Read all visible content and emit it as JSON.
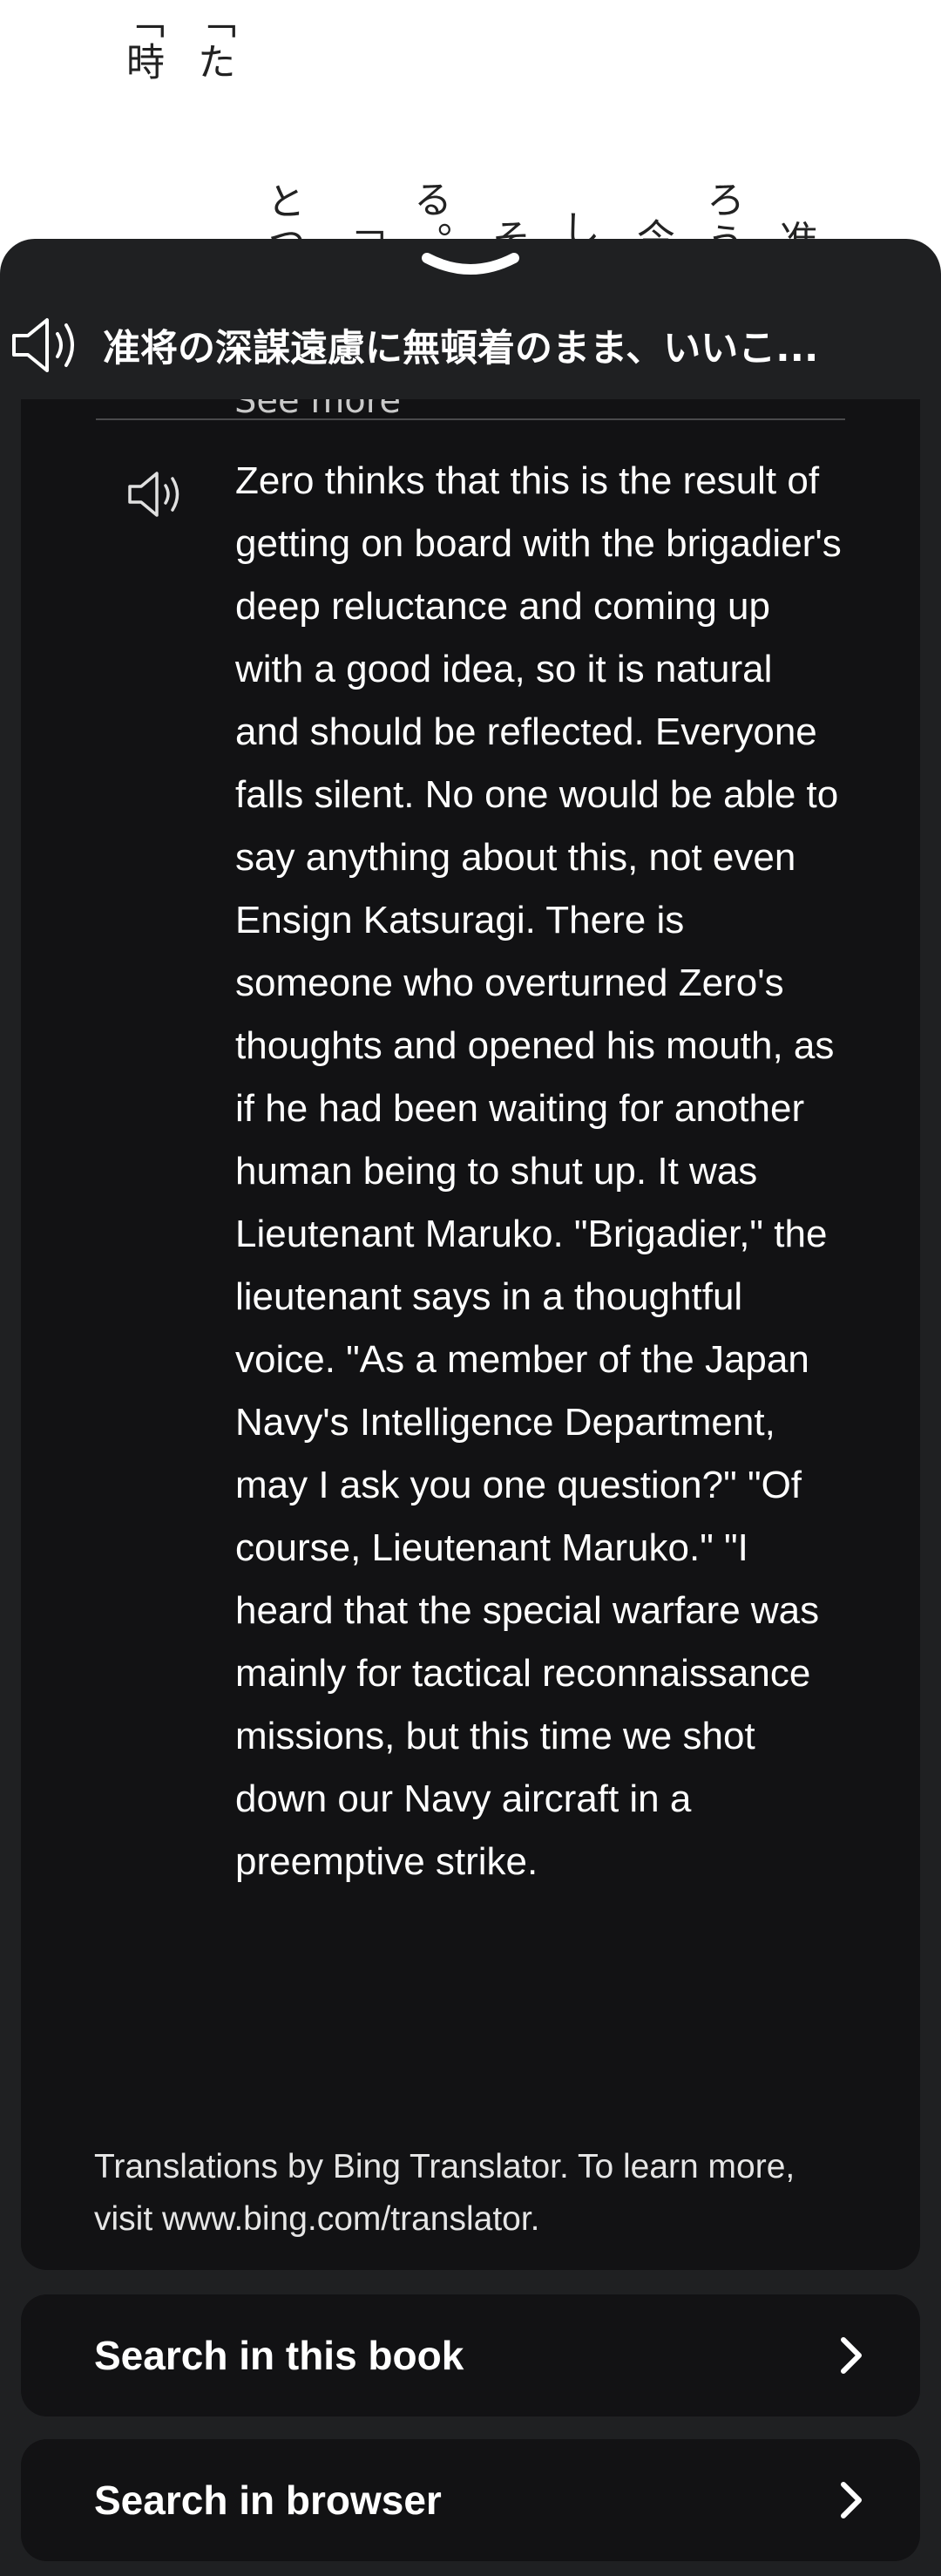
{
  "book_page": {
    "columns": [
      "「時",
      "「た",
      "とつ",
      "「進",
      "る。",
      "そ",
      "し",
      "今",
      "ろう",
      "准"
    ]
  },
  "sheet": {
    "heading": "准将の深謀遠慮に無頓着のまま、いいこ...",
    "see_more": "See more",
    "translation": "Zero thinks that this is the result of getting on board with the brigadier's deep reluctance and coming up with a good idea, so it is natural and should be reflected. Everyone falls silent. No one would be able to say anything about this, not even Ensign Katsuragi. There is someone who overturned Zero's thoughts and opened his mouth, as if he had been waiting for another human being to shut up. It was Lieutenant Maruko. \"Brigadier,\" the lieutenant says in a thoughtful voice. \"As a member of the Japan Navy's Intelligence Department, may I ask you one question?\" \"Of course, Lieutenant Maruko.\" \"I heard that the special warfare was mainly for tactical reconnaissance missions, but this time we shot down our Navy aircraft in a preemptive strike.",
    "credit": "Translations by Bing Translator. To learn more, visit www.bing.com/translator."
  },
  "actions": {
    "search_book": "Search in this book",
    "search_browser": "Search in browser"
  },
  "icons": {
    "speaker": "speaker-icon",
    "chevron": "chevron-right-icon",
    "grabber": "chevron-down-icon"
  },
  "colors": {
    "sheet_bg": "#1f2022",
    "card_bg": "#121214",
    "text": "#ffffff"
  }
}
